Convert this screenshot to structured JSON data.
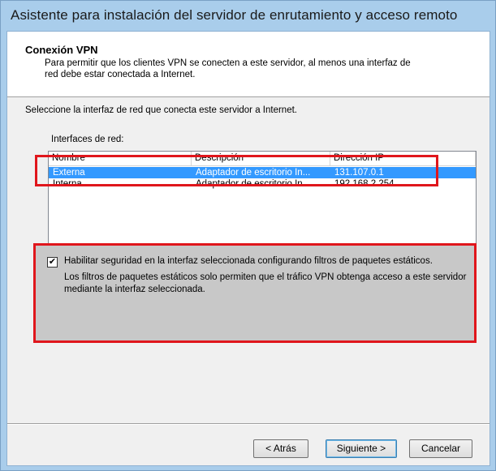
{
  "window": {
    "title": "Asistente para instalación del servidor de enrutamiento y acceso remoto"
  },
  "header": {
    "title": "Conexión VPN",
    "description": "Para permitir que los clientes VPN se conecten a este servidor, al menos una interfaz de red debe estar conectada a Internet."
  },
  "main": {
    "prompt": "Seleccione la interfaz de red que conecta este servidor a Internet.",
    "list_label": "Interfaces de red:",
    "columns": [
      "Nombre",
      "Descripción",
      "Dirección IP"
    ],
    "rows": [
      {
        "name": "Externa",
        "description": "Adaptador de escritorio In...",
        "ip": "131.107.0.1",
        "selected": true
      },
      {
        "name": "Interna",
        "description": "Adaptador de escritorio In...",
        "ip": "192.168.2.254",
        "selected": false
      }
    ],
    "checkbox": {
      "checked": true,
      "mark": "✔",
      "label": "Habilitar seguridad en la interfaz seleccionada configurando filtros de paquetes estáticos.",
      "description": "Los filtros de paquetes estáticos solo permiten que el tráfico VPN obtenga acceso a este servidor mediante la interfaz seleccionada."
    }
  },
  "footer": {
    "back_label": "< Atrás",
    "next_label": "Siguiente >",
    "cancel_label": "Cancelar"
  },
  "colors": {
    "titlebar": "#a9cdeb",
    "selection": "#3399ff",
    "highlight_box": "#e0161c",
    "panel_gray": "#c8c8c8"
  }
}
